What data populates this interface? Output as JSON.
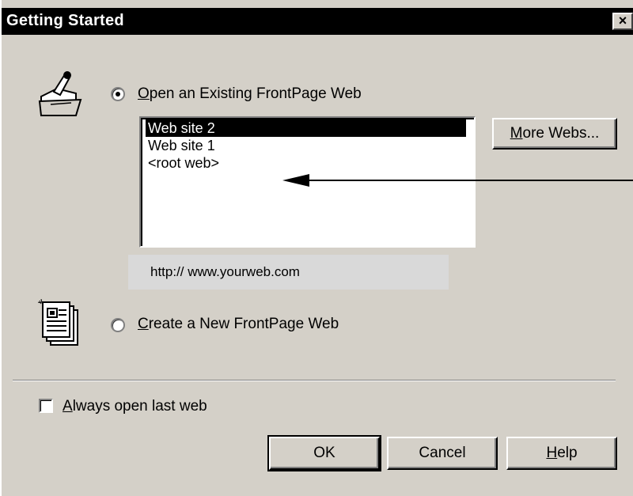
{
  "window": {
    "title": "Getting Started",
    "close_glyph": "×"
  },
  "open_option": {
    "label_mnemonic": "O",
    "label_rest": "pen an Existing FrontPage Web",
    "selected": true,
    "icon": "open-folder-icon"
  },
  "webs_list": {
    "items": [
      {
        "label": "Web site 2",
        "selected": true
      },
      {
        "label": "Web site 1",
        "selected": false
      },
      {
        "label": "<root web>",
        "selected": false
      }
    ]
  },
  "more_webs_button": {
    "mnemonic": "M",
    "rest": "ore Webs..."
  },
  "url_display": "http:// www.yourweb.com",
  "create_option": {
    "label_mnemonic": "C",
    "label_rest": "reate a New FrontPage Web",
    "selected": false,
    "icon": "new-document-icon"
  },
  "always_open": {
    "mnemonic": "A",
    "rest": "lways open last web",
    "checked": false
  },
  "buttons": {
    "ok": "OK",
    "cancel": "Cancel",
    "help_mnemonic": "H",
    "help_rest": "elp"
  },
  "annotation": {
    "icon": "arrow-pointer-icon"
  }
}
